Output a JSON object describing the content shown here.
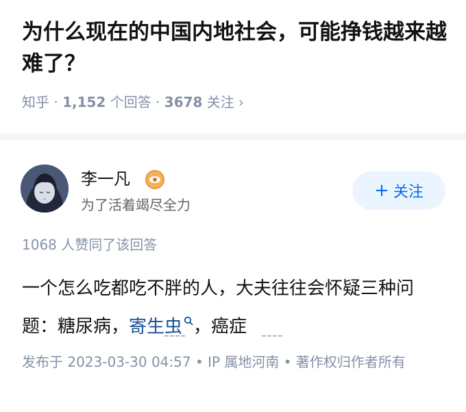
{
  "question": {
    "title": "为什么现在的中国内地社会，可能挣钱越来越难了？",
    "source": "知乎",
    "answer_count": "1,152",
    "answer_unit": "个回答",
    "follow_count": "3678",
    "follow_unit": "关注"
  },
  "author": {
    "name": "李一凡",
    "bio": "为了活着竭尽全力",
    "avatar_icon": "avatar-anime-portrait",
    "badge_icon": "eye-badge-icon",
    "follow_button": "关注"
  },
  "answer": {
    "likes_text": "1068 人赞同了该回答",
    "text_before": "一个怎么吃都吃不胖的人，大夫往往会怀疑三种问题：糖尿病，",
    "keyword": "寄生虫",
    "text_after": "，癌症",
    "published": "发布于 2023-03-30 04:57 • IP 属地河南 • 著作权归作者所有"
  },
  "colors": {
    "title": "#121212",
    "meta": "#8590a6",
    "link": "#175199",
    "follow_text": "#056de8",
    "follow_bg": "#ebf5ff"
  }
}
